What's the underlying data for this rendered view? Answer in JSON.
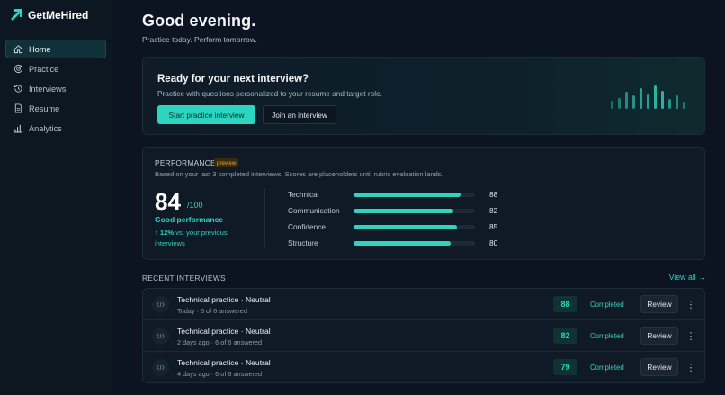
{
  "brand": {
    "name": "GetMeHired",
    "accent": "#2dd4bf"
  },
  "sidebar": {
    "items": [
      {
        "label": "Home",
        "icon": "home-icon",
        "active": true
      },
      {
        "label": "Practice",
        "icon": "target-icon",
        "active": false
      },
      {
        "label": "Interviews",
        "icon": "history-icon",
        "active": false
      },
      {
        "label": "Resume",
        "icon": "document-icon",
        "active": false
      },
      {
        "label": "Analytics",
        "icon": "bar-chart-icon",
        "active": false
      }
    ]
  },
  "header": {
    "greeting": "Good evening.",
    "subtitle": "Practice today. Perform tomorrow."
  },
  "hero": {
    "title": "Ready for your next interview?",
    "subtitle": "Practice with questions personalized to your resume and target role.",
    "primary_button": "Start practice interview",
    "secondary_button": "Join an interview"
  },
  "performance": {
    "title": "PERFORMANCE",
    "badge": "preview",
    "subtitle": "Based on your last 3 completed interviews. Scores are placeholders until rubric evaluation lands.",
    "score": "84",
    "score_max": "/100",
    "score_label": "Good performance",
    "delta_arrow": "↑",
    "delta_value": "12%",
    "delta_text": " vs. your previous interviews",
    "metrics": [
      {
        "label": "Technical",
        "value": "88",
        "fraction": 0.88
      },
      {
        "label": "Communication",
        "value": "82",
        "fraction": 0.82
      },
      {
        "label": "Confidence",
        "value": "85",
        "fraction": 0.85
      },
      {
        "label": "Structure",
        "value": "80",
        "fraction": 0.8
      }
    ]
  },
  "recent": {
    "title": "RECENT INTERVIEWS",
    "view_all": "View all →",
    "rows": [
      {
        "title": "Technical practice · Neutral",
        "meta": "Today · 6 of 6 answered",
        "score": "88",
        "status": "Completed",
        "action": "Review",
        "more": "⋮"
      },
      {
        "title": "Technical practice · Neutral",
        "meta": "2 days ago · 6 of 6 answered",
        "score": "82",
        "status": "Completed",
        "action": "Review",
        "more": "⋮"
      },
      {
        "title": "Technical practice · Neutral",
        "meta": "4 days ago · 6 of 6 answered",
        "score": "79",
        "status": "Completed",
        "action": "Review",
        "more": "⋮"
      }
    ]
  }
}
